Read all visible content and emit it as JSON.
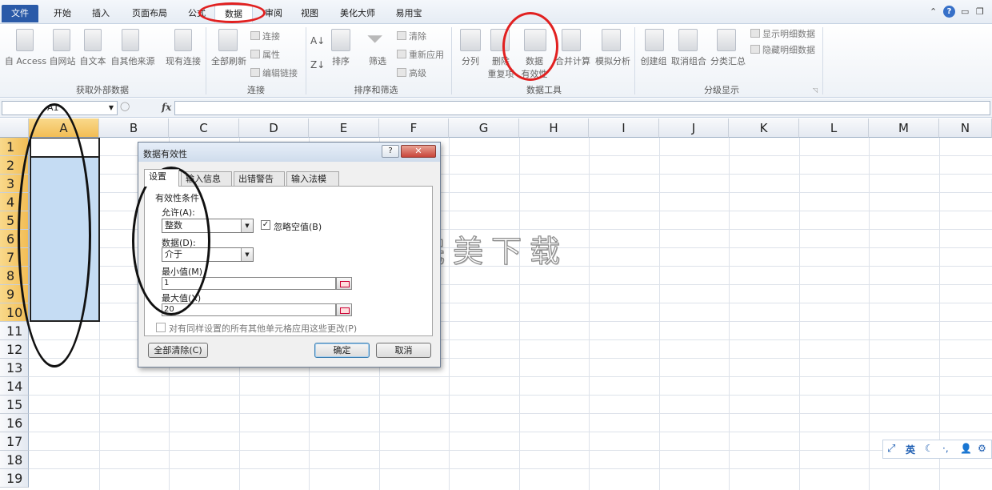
{
  "tabs": [
    {
      "label": "文件",
      "left": 0
    },
    {
      "label": "开始"
    },
    {
      "label": "插入"
    },
    {
      "label": "页面布局"
    },
    {
      "label": "公式"
    },
    {
      "label": "数据"
    },
    {
      "label": "审阅"
    },
    {
      "label": "视图"
    },
    {
      "label": "美化大师"
    },
    {
      "label": "易用宝"
    }
  ],
  "ribbon": {
    "groups": {
      "external": "获取外部数据",
      "connections": "连接",
      "sort_filter": "排序和筛选",
      "data_tools": "数据工具",
      "outline": "分级显示"
    },
    "buttons": {
      "access": "自 Access",
      "web": "自网站",
      "text": "自文本",
      "other_sources": "自其他来源",
      "existing_conn": "现有连接",
      "refresh_all": "全部刷新",
      "connections": "连接",
      "properties": "属性",
      "edit_links": "编辑链接",
      "sort": "排序",
      "filter": "筛选",
      "clear": "清除",
      "reapply": "重新应用",
      "advanced": "高级",
      "text_to_columns": "分列",
      "remove_duplicates_1": "删除",
      "remove_duplicates_2": "重复项",
      "data_validation_1": "数据",
      "data_validation_2": "有效性",
      "consolidate": "合并计算",
      "what_if": "模拟分析",
      "group": "创建组",
      "ungroup": "取消组合",
      "subtotal": "分类汇总",
      "show_detail": "显示明细数据",
      "hide_detail": "隐藏明细数据"
    }
  },
  "formula_bar": {
    "name_box": "A1",
    "fx": "fx"
  },
  "grid": {
    "columns": [
      "A",
      "B",
      "C",
      "D",
      "E",
      "F",
      "G",
      "H",
      "I",
      "J",
      "K",
      "L",
      "M",
      "N"
    ],
    "rows": [
      "1",
      "2",
      "3",
      "4",
      "5",
      "6",
      "7",
      "8",
      "9",
      "10",
      "11",
      "12",
      "13",
      "14",
      "15",
      "16",
      "17",
      "18",
      "19"
    ]
  },
  "dialog": {
    "title": "数据有效性",
    "help": "?",
    "close": "✕",
    "tabs": [
      "设置",
      "输入信息",
      "出错警告",
      "输入法模式"
    ],
    "criteria_label": "有效性条件",
    "allow_label": "允许(A):",
    "allow_value": "整数",
    "ignore_blank_label": "忽略空值(B)",
    "data_label": "数据(D):",
    "data_value": "介于",
    "min_label": "最小值(M)",
    "min_value": "1",
    "max_label": "最大值(X)",
    "max_value": "20",
    "apply_all_label": "对有同样设置的所有其他单元格应用这些更改(P)",
    "clear_all": "全部清除(C)",
    "ok": "确定",
    "cancel": "取消"
  },
  "watermark": "完美下载",
  "ime": {
    "lang": "英"
  }
}
